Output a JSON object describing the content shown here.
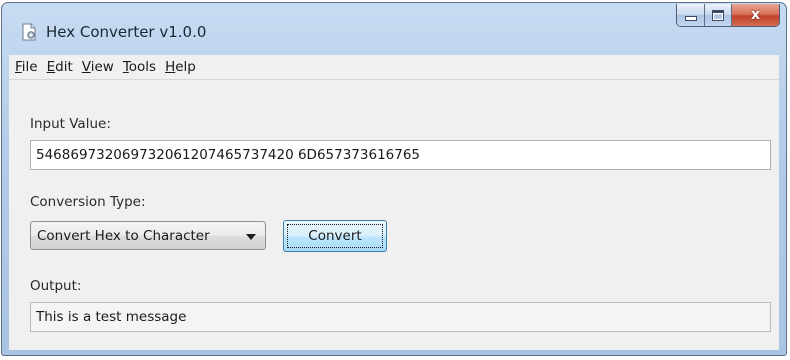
{
  "window": {
    "title": "Hex Converter v1.0.0",
    "app_icon": "document-gear-icon",
    "controls": {
      "minimize_icon": "minimize-icon",
      "maximize_icon": "maximize-icon",
      "close_icon": "close-icon",
      "close_glyph": "x"
    }
  },
  "menu": {
    "items": [
      {
        "mnemonic": "F",
        "rest": "ile"
      },
      {
        "mnemonic": "E",
        "rest": "dit"
      },
      {
        "mnemonic": "V",
        "rest": "iew"
      },
      {
        "mnemonic": "T",
        "rest": "ools"
      },
      {
        "mnemonic": "H",
        "rest": "elp"
      }
    ]
  },
  "form": {
    "input_label": "Input Value:",
    "input_value": "546869732069732061207465737420 6D657373616765",
    "conversion_label": "Conversion Type:",
    "conversion_selected": "Convert Hex to Character",
    "convert_button": "Convert",
    "output_label": "Output:",
    "output_value": "This is a test message"
  },
  "colors": {
    "titlebar": "#b4cce9",
    "close_button": "#c4422b",
    "client_background": "#f0f0f0",
    "button_focus_border": "#3c7fb1"
  }
}
